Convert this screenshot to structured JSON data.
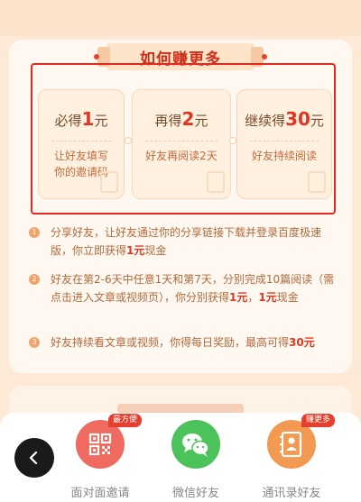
{
  "section": {
    "title": "如何赚更多"
  },
  "rewards": [
    {
      "prefix": "必得",
      "amount": "1",
      "unit": "元",
      "desc": "让好友填写你的邀请码"
    },
    {
      "prefix": "再得",
      "amount": "2",
      "unit": "元",
      "desc": "好友再阅读2天"
    },
    {
      "prefix": "继续得",
      "amount": "30",
      "unit": "元",
      "desc": "好友持续阅读"
    }
  ],
  "steps": [
    {
      "num": "1",
      "text_a": "分享好友，让好友通过你的分享链接下载并登录百度极速版，你立即获得",
      "highlight": "1元",
      "text_b": "现金"
    },
    {
      "num": "2",
      "text_a": "好友在第2-6天中任意1天和第7天，分别完成10篇阅读（需点击进入文章或视频页），你分别获得",
      "highlight": "1元",
      "text_mid": "，",
      "highlight2": "1元",
      "text_b": "现金"
    },
    {
      "num": "3",
      "text_a": "好友持续看文章或视频，你得每日奖励，最高可得",
      "highlight": "30元",
      "text_b": ""
    }
  ],
  "share_sheet": {
    "items": [
      {
        "label": "面对面邀请",
        "icon": "qr-code-icon",
        "tag": "最方便",
        "color": "#ef6a5f"
      },
      {
        "label": "微信好友",
        "icon": "wechat-icon",
        "color": "#4cc25a"
      },
      {
        "label": "通讯录好友",
        "icon": "contacts-icon",
        "tag": "赚更多",
        "color": "#f39a52"
      }
    ]
  }
}
